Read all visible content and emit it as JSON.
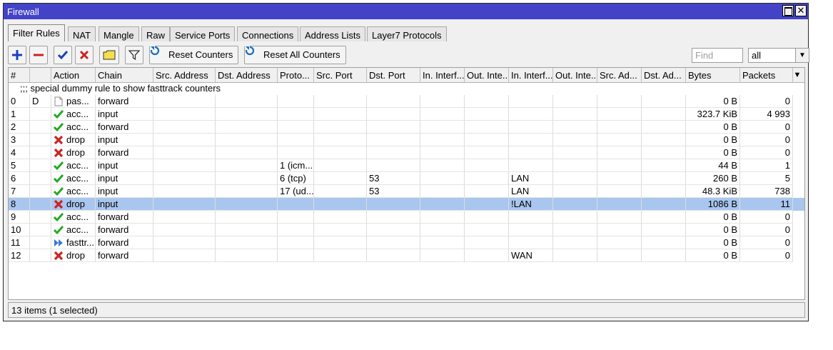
{
  "window": {
    "title": "Firewall"
  },
  "tabs": [
    "Filter Rules",
    "NAT",
    "Mangle",
    "Raw",
    "Service Ports",
    "Connections",
    "Address Lists",
    "Layer7 Protocols"
  ],
  "toolbar": {
    "reset_counters": "Reset Counters",
    "reset_all_counters": "Reset All Counters",
    "find_placeholder": "Find",
    "filter_value": "all"
  },
  "columns": [
    "#",
    "",
    "Action",
    "Chain",
    "Src. Address",
    "Dst. Address",
    "Proto...",
    "Src. Port",
    "Dst. Port",
    "In. Interf...",
    "Out. Inte...",
    "In. Interf...",
    "Out. Inte...",
    "Src. Ad...",
    "Dst. Ad...",
    "Bytes",
    "Packets"
  ],
  "dummy_rule": ";;; special dummy rule to show fasttrack counters",
  "rows": [
    {
      "num": "0",
      "flag": "D",
      "action": "pas...",
      "icon": "passthrough-icon",
      "chain": "forward",
      "proto": "",
      "dst_port": "",
      "in_iface": "",
      "bytes": "0 B",
      "packets": "0"
    },
    {
      "num": "1",
      "flag": "",
      "action": "acc...",
      "icon": "accept-icon",
      "chain": "input",
      "proto": "",
      "dst_port": "",
      "in_iface": "",
      "bytes": "323.7 KiB",
      "packets": "4 993"
    },
    {
      "num": "2",
      "flag": "",
      "action": "acc...",
      "icon": "accept-icon",
      "chain": "forward",
      "proto": "",
      "dst_port": "",
      "in_iface": "",
      "bytes": "0 B",
      "packets": "0"
    },
    {
      "num": "3",
      "flag": "",
      "action": "drop",
      "icon": "drop-icon",
      "chain": "input",
      "proto": "",
      "dst_port": "",
      "in_iface": "",
      "bytes": "0 B",
      "packets": "0"
    },
    {
      "num": "4",
      "flag": "",
      "action": "drop",
      "icon": "drop-icon",
      "chain": "forward",
      "proto": "",
      "dst_port": "",
      "in_iface": "",
      "bytes": "0 B",
      "packets": "0"
    },
    {
      "num": "5",
      "flag": "",
      "action": "acc...",
      "icon": "accept-icon",
      "chain": "input",
      "proto": "1 (icm...",
      "dst_port": "",
      "in_iface": "",
      "bytes": "44 B",
      "packets": "1"
    },
    {
      "num": "6",
      "flag": "",
      "action": "acc...",
      "icon": "accept-icon",
      "chain": "input",
      "proto": "6 (tcp)",
      "dst_port": "53",
      "in_iface": "LAN",
      "bytes": "260 B",
      "packets": "5"
    },
    {
      "num": "7",
      "flag": "",
      "action": "acc...",
      "icon": "accept-icon",
      "chain": "input",
      "proto": "17 (ud...",
      "dst_port": "53",
      "in_iface": "LAN",
      "bytes": "48.3 KiB",
      "packets": "738"
    },
    {
      "num": "8",
      "flag": "",
      "action": "drop",
      "icon": "drop-icon",
      "chain": "input",
      "proto": "",
      "dst_port": "",
      "in_iface": "!LAN",
      "bytes": "1086 B",
      "packets": "11",
      "selected": true
    },
    {
      "num": "9",
      "flag": "",
      "action": "acc...",
      "icon": "accept-icon",
      "chain": "forward",
      "proto": "",
      "dst_port": "",
      "in_iface": "",
      "bytes": "0 B",
      "packets": "0"
    },
    {
      "num": "10",
      "flag": "",
      "action": "acc...",
      "icon": "accept-icon",
      "chain": "forward",
      "proto": "",
      "dst_port": "",
      "in_iface": "",
      "bytes": "0 B",
      "packets": "0"
    },
    {
      "num": "11",
      "flag": "",
      "action": "fasttr...",
      "icon": "fasttrack-icon",
      "chain": "forward",
      "proto": "",
      "dst_port": "",
      "in_iface": "",
      "bytes": "0 B",
      "packets": "0"
    },
    {
      "num": "12",
      "flag": "",
      "action": "drop",
      "icon": "drop-icon",
      "chain": "forward",
      "proto": "",
      "dst_port": "",
      "in_iface": "WAN",
      "bytes": "0 B",
      "packets": "0"
    }
  ],
  "status": "13 items (1 selected)",
  "colors": {
    "titlebar": "#4343c8",
    "selected_row": "#a9c6ee",
    "accept": "#22aa22",
    "drop": "#cc2222",
    "add": "#1a3fbf"
  }
}
